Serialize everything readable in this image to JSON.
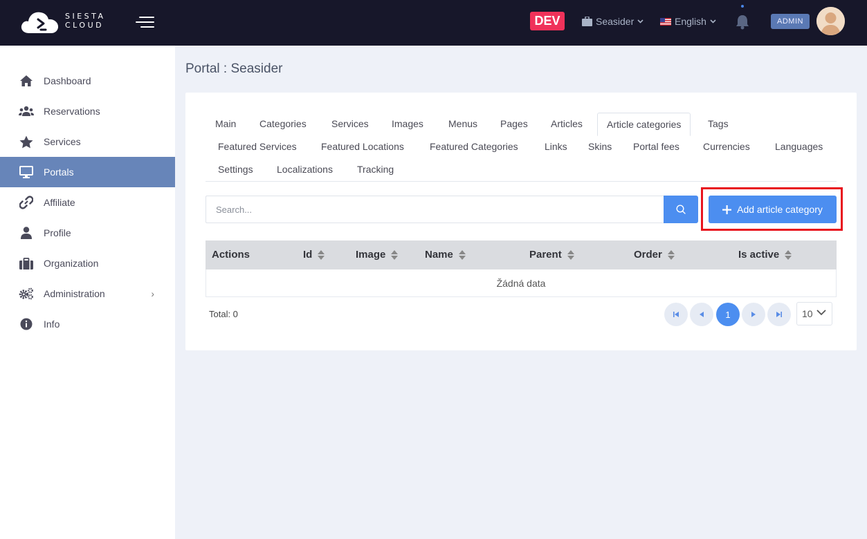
{
  "header": {
    "logo_line1": "SIESTA",
    "logo_line2": "CLOUD",
    "env_badge": "DEV",
    "organization": "Seasider",
    "language": "English",
    "role_badge": "ADMIN",
    "icons": [
      "menu-icon",
      "briefcase-icon",
      "us-flag-icon",
      "chevron-down-icon",
      "bell-icon"
    ]
  },
  "sidebar": {
    "items": [
      {
        "label": "Dashboard",
        "icon": "home-icon"
      },
      {
        "label": "Reservations",
        "icon": "users-icon"
      },
      {
        "label": "Services",
        "icon": "star-icon"
      },
      {
        "label": "Portals",
        "icon": "monitor-icon",
        "active": true
      },
      {
        "label": "Affiliate",
        "icon": "link-icon"
      },
      {
        "label": "Profile",
        "icon": "user-icon"
      },
      {
        "label": "Organization",
        "icon": "briefcase-icon"
      },
      {
        "label": "Administration",
        "icon": "gears-icon",
        "has_submenu": true
      },
      {
        "label": "Info",
        "icon": "info-icon"
      }
    ],
    "chevron": "›"
  },
  "page": {
    "title": "Portal : Seasider"
  },
  "tabs": [
    "Main",
    "Categories",
    "Services",
    "Images",
    "Menus",
    "Pages",
    "Articles",
    "Article categories",
    "Tags",
    "Featured Services",
    "Featured Locations",
    "Featured Categories",
    "Links",
    "Skins",
    "Portal fees",
    "Currencies",
    "Languages",
    "Settings",
    "Localizations",
    "Tracking"
  ],
  "active_tab": "Article categories",
  "toolbar": {
    "search_placeholder": "Search...",
    "add_label": "Add article category"
  },
  "table": {
    "columns": [
      "Actions",
      "Id",
      "Image",
      "Name",
      "Parent",
      "Order",
      "Is active"
    ],
    "sortable": [
      false,
      true,
      true,
      true,
      true,
      true,
      true
    ],
    "empty_text": "Žádná data"
  },
  "pagination": {
    "total_label": "Total: 0",
    "current_page": "1",
    "page_size": "10"
  },
  "colors": {
    "topbar": "#17172a",
    "accent": "#4c8ef0",
    "sidebar_active": "#6785b9",
    "dev_badge": "#f0325a",
    "highlight": "#e8141e"
  }
}
